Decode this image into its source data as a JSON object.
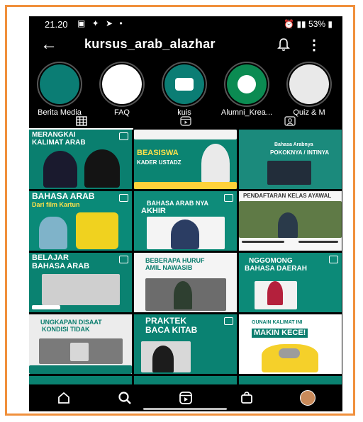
{
  "status": {
    "time": "21.20",
    "battery": "53%"
  },
  "profile": {
    "username": "kursus_arab_alazhar"
  },
  "highlights": [
    {
      "label": "Berita Media"
    },
    {
      "label": "FAQ"
    },
    {
      "label": "kuis"
    },
    {
      "label": "Alumni_Krea..."
    },
    {
      "label": "Quiz & M"
    }
  ],
  "posts": [
    {
      "line1": "MERANGKAI",
      "line2": "KALIMAT ARAB"
    },
    {
      "line1": "BEASISWA",
      "line2": "KADER USTADZ"
    },
    {
      "line1": "Bahasa Arabnya",
      "line2": "POKOKNYA / INTINYA"
    },
    {
      "line1": "BAHASA ARAB",
      "line2": "Dari film Kartun"
    },
    {
      "line1": "BAHASA ARAB NYA",
      "line2": "AKHIR"
    },
    {
      "line1": "PENDAFTARAN KELAS AYAWAL",
      "line2": ""
    },
    {
      "line1": "BELAJAR",
      "line2": "BAHASA ARAB"
    },
    {
      "line1": "BEBERAPA HURUF",
      "line2": "AMIL NAWASIB"
    },
    {
      "line1": "NGGOMONG",
      "line2": "BAHASA DAERAH"
    },
    {
      "line1": "UNGKAPAN DISAAT",
      "line2": "KONDISI TIDAK"
    },
    {
      "line1": "PRAKTEK",
      "line2": "BACA KITAB"
    },
    {
      "line1": "GUNAIN KALIMAT INI",
      "line2": "MAKIN KECE!"
    }
  ],
  "colors": {
    "teal": "#00766a",
    "accent": "#f0903c"
  }
}
